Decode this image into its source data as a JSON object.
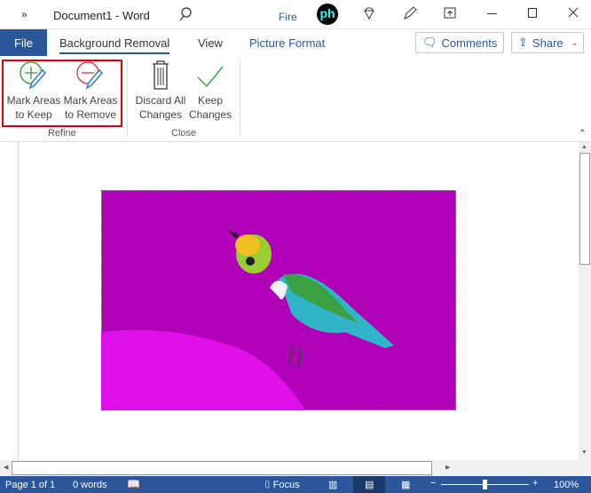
{
  "titlebar": {
    "expand": "»",
    "title": "Document1 - Word",
    "search_hint": "Fire",
    "logo_text": "ph"
  },
  "tabs": {
    "file": "File",
    "items": [
      "Background Removal",
      "View",
      "Picture Format"
    ],
    "active": "Background Removal",
    "comments": "Comments",
    "share": "Share"
  },
  "ribbon": {
    "buttons": [
      {
        "line1": "Mark Areas",
        "line2": "to Keep"
      },
      {
        "line1": "Mark Areas",
        "line2": "to Remove"
      },
      {
        "line1": "Discard All",
        "line2": "Changes"
      },
      {
        "line1": "Keep",
        "line2": "Changes"
      }
    ],
    "groups": [
      "Refine",
      "Close"
    ]
  },
  "status": {
    "page": "Page 1 of 1",
    "words": "0 words",
    "focus": "Focus",
    "zoom": "100%",
    "zoom_level_percent": 100
  },
  "colors": {
    "accent": "#2b579a",
    "highlight": "#e00000",
    "removal": "#b000b8"
  }
}
